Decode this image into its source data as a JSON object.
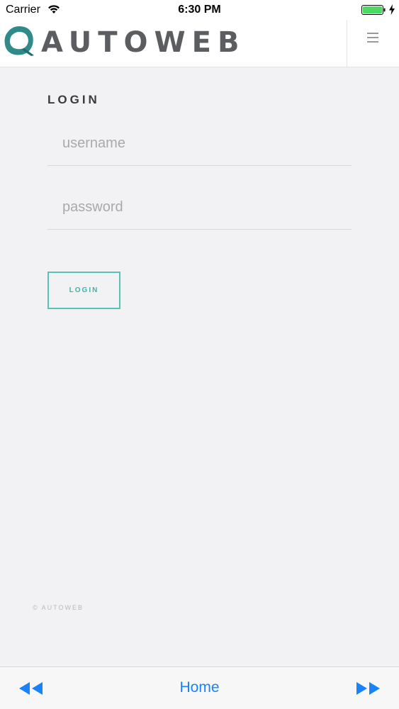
{
  "status_bar": {
    "carrier": "Carrier",
    "time": "6:30 PM",
    "wifi_icon": "wifi-icon",
    "battery_icon": "battery-icon",
    "battery_color": "#4cd964"
  },
  "header": {
    "logo_text": "AUTOWEB",
    "logo_icon": "autoweb-logo-mark",
    "menu_icon": "hamburger-icon",
    "brand_color": "#2e8b8a"
  },
  "login": {
    "heading": "LOGIN",
    "username_placeholder": "username",
    "username_value": "",
    "password_placeholder": "password",
    "password_value": "",
    "button_label": "LOGIN",
    "accent_color": "#58c4b8"
  },
  "footer": {
    "copyright": "© AUTOWEB"
  },
  "toolbar": {
    "rewind_icon": "rewind-icon",
    "home_label": "Home",
    "forward_icon": "fast-forward-icon",
    "link_color": "#1a82fb"
  }
}
